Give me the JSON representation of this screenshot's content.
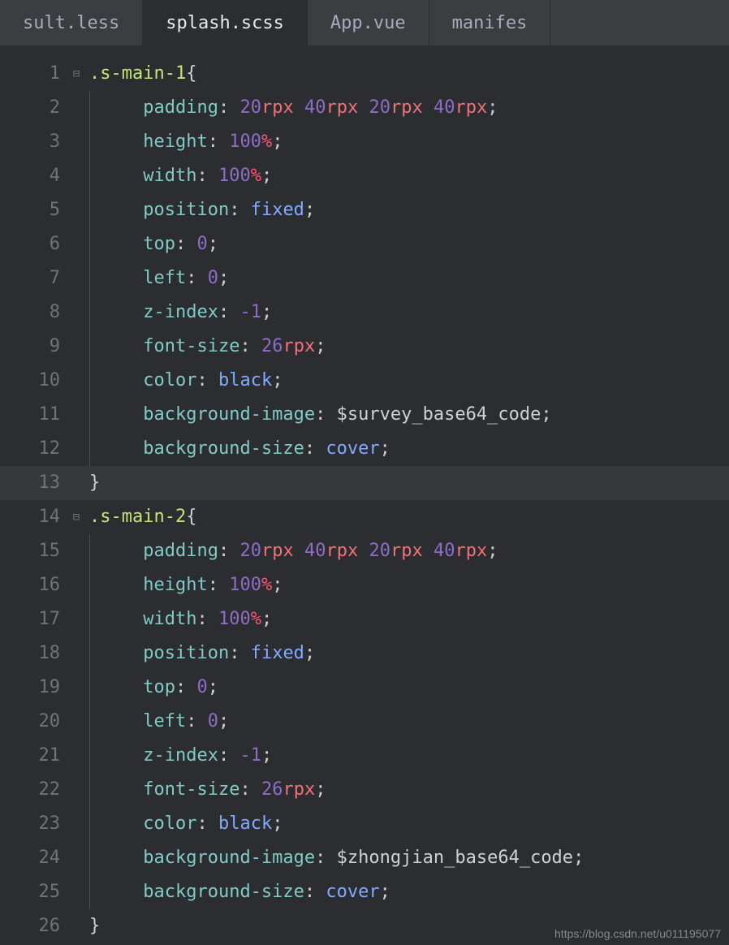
{
  "tabs": [
    {
      "label": "sult.less",
      "active": false
    },
    {
      "label": "splash.scss",
      "active": true
    },
    {
      "label": "App.vue",
      "active": false
    },
    {
      "label": "manifes",
      "active": false
    }
  ],
  "watermark": "https://blog.csdn.net/u011195077",
  "code": {
    "l1": {
      "num": "1",
      "fold": "⊟",
      "sel": ".s-main-1",
      "brace": "{"
    },
    "l2": {
      "num": "2",
      "prop": "padding",
      "v1": "20",
      "u1": "rpx",
      "v2": "40",
      "u2": "rpx",
      "v3": "20",
      "u3": "rpx",
      "v4": "40",
      "u4": "rpx"
    },
    "l3": {
      "num": "3",
      "prop": "height",
      "v1": "100",
      "u1": "%"
    },
    "l4": {
      "num": "4",
      "prop": "width",
      "v1": "100",
      "u1": "%"
    },
    "l5": {
      "num": "5",
      "prop": "position",
      "val": "fixed"
    },
    "l6": {
      "num": "6",
      "prop": "top",
      "v1": "0"
    },
    "l7": {
      "num": "7",
      "prop": "left",
      "v1": "0"
    },
    "l8": {
      "num": "8",
      "prop": "z-index",
      "v1": "-1"
    },
    "l9": {
      "num": "9",
      "prop": "font-size",
      "v1": "26",
      "u1": "rpx"
    },
    "l10": {
      "num": "10",
      "prop": "color",
      "val": "black"
    },
    "l11": {
      "num": "11",
      "prop": "background-image",
      "var": "$survey_base64_code"
    },
    "l12": {
      "num": "12",
      "prop": "background-size",
      "val": "cover"
    },
    "l13": {
      "num": "13",
      "brace": "}"
    },
    "l14": {
      "num": "14",
      "fold": "⊟",
      "sel": ".s-main-2",
      "brace": "{"
    },
    "l15": {
      "num": "15",
      "prop": "padding",
      "v1": "20",
      "u1": "rpx",
      "v2": "40",
      "u2": "rpx",
      "v3": "20",
      "u3": "rpx",
      "v4": "40",
      "u4": "rpx"
    },
    "l16": {
      "num": "16",
      "prop": "height",
      "v1": "100",
      "u1": "%"
    },
    "l17": {
      "num": "17",
      "prop": "width",
      "v1": "100",
      "u1": "%"
    },
    "l18": {
      "num": "18",
      "prop": "position",
      "val": "fixed"
    },
    "l19": {
      "num": "19",
      "prop": "top",
      "v1": "0"
    },
    "l20": {
      "num": "20",
      "prop": "left",
      "v1": "0"
    },
    "l21": {
      "num": "21",
      "prop": "z-index",
      "v1": "-1"
    },
    "l22": {
      "num": "22",
      "prop": "font-size",
      "v1": "26",
      "u1": "rpx"
    },
    "l23": {
      "num": "23",
      "prop": "color",
      "val": "black"
    },
    "l24": {
      "num": "24",
      "prop": "background-image",
      "var": "$zhongjian_base64_code"
    },
    "l25": {
      "num": "25",
      "prop": "background-size",
      "val": "cover"
    },
    "l26": {
      "num": "26",
      "brace": "}"
    }
  }
}
